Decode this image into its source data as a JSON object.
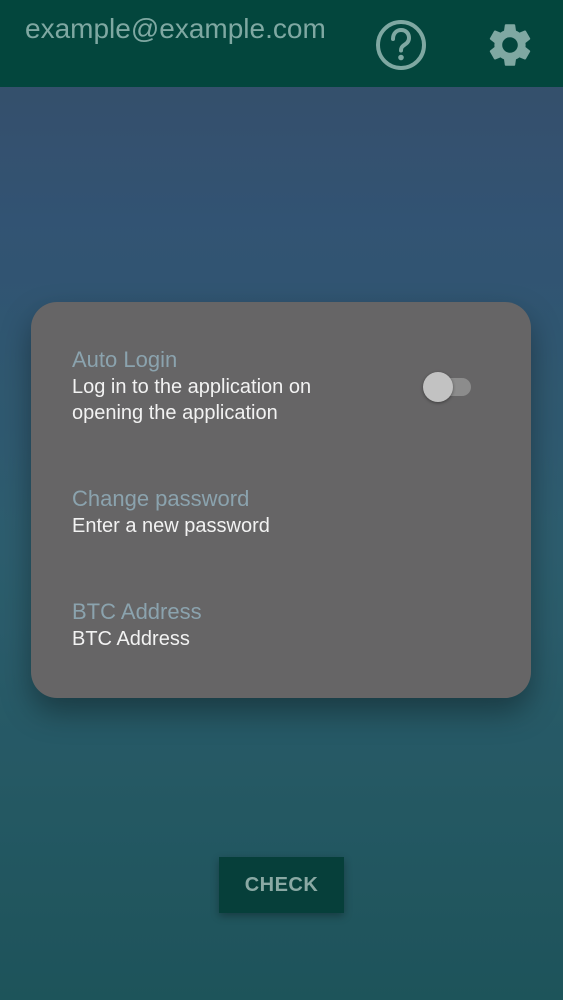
{
  "header": {
    "account_email": "example@example.com",
    "help_icon": "help-circle-icon",
    "settings_icon": "gear-icon"
  },
  "settings_dialog": {
    "auto_login": {
      "title": "Auto Login",
      "summary": "Log in to the application on opening the application",
      "enabled": false
    },
    "change_password": {
      "title": "Change password",
      "summary": "Enter a new password"
    },
    "btc_address": {
      "title": "BTC Address",
      "summary": "BTC Address"
    }
  },
  "main": {
    "check_label": "CHECK"
  },
  "colors": {
    "top_bar": "#03463d",
    "dialog_background": "#666566",
    "preference_title": "#8ba3ae",
    "check_button": "#063f3a"
  }
}
